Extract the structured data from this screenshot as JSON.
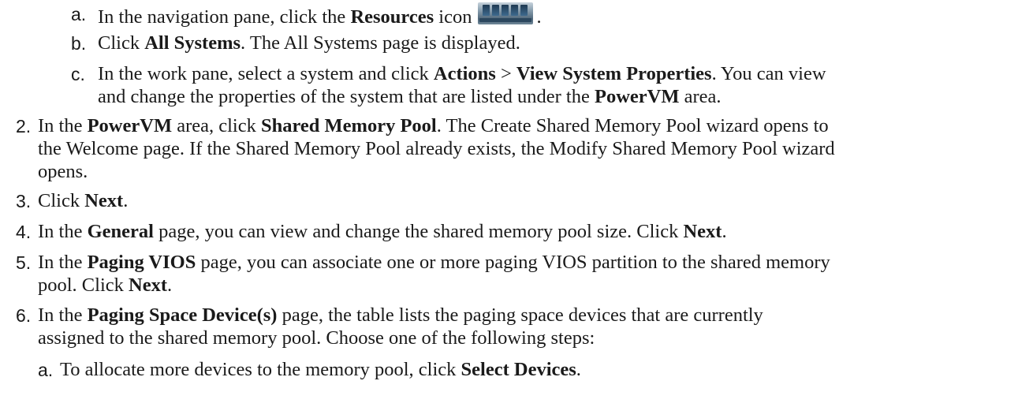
{
  "marker_a": "a.",
  "marker_b": "b.",
  "marker_c": "c.",
  "marker_2": "2.",
  "marker_3": "3.",
  "marker_4": "4.",
  "marker_5": "5.",
  "marker_6": "6.",
  "marker_6a": "a.",
  "sub_a": {
    "t1": "In the navigation pane, click the ",
    "b1": "Resources",
    "t2": " icon",
    "icon": "resources-icon",
    "t3": "."
  },
  "sub_b": {
    "t1": "Click ",
    "b1": "All Systems",
    "t2": ". The All Systems page is displayed."
  },
  "sub_c": {
    "t1": "In the work pane, select a system and click ",
    "b1": "Actions",
    "t2": " > ",
    "b2": "View System Properties",
    "t3": ". You can view",
    "t4": "and change the properties of the system that are listed under the ",
    "b3": "PowerVM",
    "t5": " area."
  },
  "step2": {
    "t1": "In the ",
    "b1": "PowerVM",
    "t2": " area, click ",
    "b2": "Shared Memory Pool",
    "t3": ". The Create Shared Memory Pool wizard opens to",
    "t4": "the Welcome page. If the Shared Memory Pool already exists, the Modify Shared Memory Pool wizard",
    "t5": "opens."
  },
  "step3": {
    "t1": "Click ",
    "b1": "Next",
    "t2": "."
  },
  "step4": {
    "t1": "In the ",
    "b1": "General",
    "t2": " page, you can view and change the shared memory pool size. Click ",
    "b2": "Next",
    "t3": "."
  },
  "step5": {
    "t1": "In the ",
    "b1": "Paging VIOS",
    "t2": " page, you can associate one or more paging VIOS partition to the shared memory",
    "t3": "pool. Click ",
    "b2": "Next",
    "t4": "."
  },
  "step6": {
    "t1": "In the ",
    "b1": "Paging Space Device(s)",
    "t2": " page, the table lists the paging space devices that are currently",
    "t3": "assigned to the shared memory pool. Choose one of the following steps:"
  },
  "sub_6a": {
    "t1": "To allocate more devices to the memory pool, click ",
    "b1": "Select Devices",
    "t2": "."
  }
}
